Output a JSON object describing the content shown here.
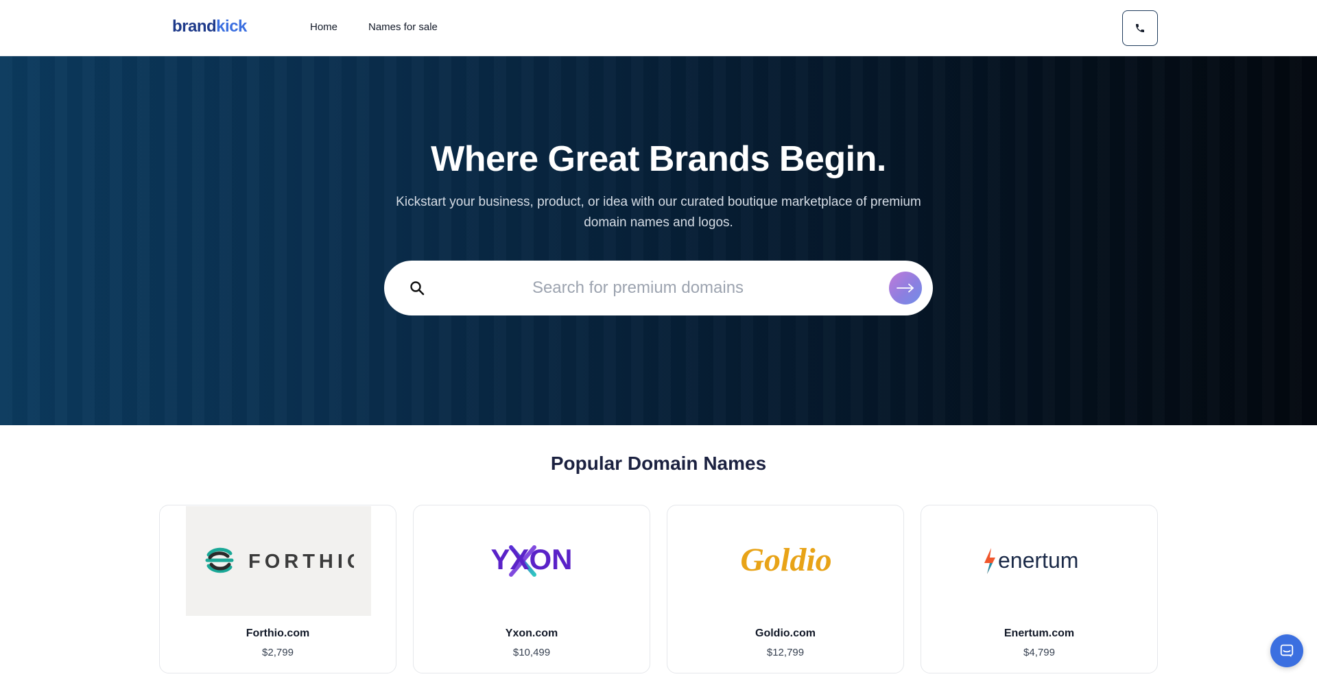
{
  "header": {
    "logo_part1": "brand",
    "logo_part2": "kick",
    "nav": {
      "home": "Home",
      "names_for_sale": "Names for sale"
    },
    "phone_icon": "phone-icon"
  },
  "hero": {
    "title": "Where Great Brands Begin.",
    "subtitle": "Kickstart your business, product, or idea with our curated boutique marketplace of premium domain names and logos.",
    "search": {
      "placeholder": "Search for premium domains",
      "value": "",
      "icon": "search-icon",
      "submit_icon": "arrow-right-icon"
    }
  },
  "popular": {
    "title": "Popular Domain Names",
    "cards": [
      {
        "logo_text": "FORTHIO",
        "name": "Forthio.com",
        "price": "$2,799"
      },
      {
        "logo_text": "YXON",
        "name": "Yxon.com",
        "price": "$10,499"
      },
      {
        "logo_text": "Goldio",
        "name": "Goldio.com",
        "price": "$12,799"
      },
      {
        "logo_text": "enertum",
        "name": "Enertum.com",
        "price": "$4,799"
      }
    ]
  },
  "chat": {
    "icon": "chat-icon"
  },
  "colors": {
    "brand_dark": "#1e3a8a",
    "brand_light": "#3b6fe0",
    "hero_left": "#0b3a5e",
    "hero_right": "#03080f",
    "gold": "#e8a317"
  }
}
